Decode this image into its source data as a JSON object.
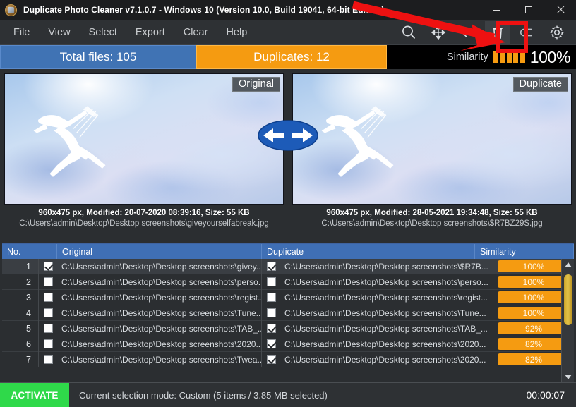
{
  "window": {
    "title": "Duplicate Photo Cleaner v7.1.0.7 - Windows 10 (Version 10.0, Build 19041, 64-bit Edition)",
    "logo_icon": "app-logo-icon",
    "minimize_icon": "minimize-icon",
    "maximize_icon": "maximize-icon",
    "close_icon": "close-icon"
  },
  "menu": {
    "items": [
      {
        "label": "File"
      },
      {
        "label": "View"
      },
      {
        "label": "Select"
      },
      {
        "label": "Export"
      },
      {
        "label": "Clear"
      },
      {
        "label": "Help"
      }
    ]
  },
  "toolbar": {
    "buttons": [
      {
        "name": "search-icon",
        "title": "Search"
      },
      {
        "name": "move-arrows-icon",
        "title": "Move"
      },
      {
        "name": "link-chain-icon",
        "title": "Link"
      },
      {
        "name": "trash-icon",
        "title": "Delete"
      },
      {
        "name": "undo-icon",
        "title": "Undo"
      },
      {
        "name": "gear-icon",
        "title": "Settings"
      }
    ],
    "highlighted": "trash-icon"
  },
  "counters": {
    "total_files_label": "Total files: 105",
    "duplicates_label": "Duplicates: 12",
    "similarity_label": "Similarity",
    "similarity_percent": "100%",
    "similarity_bars": 5,
    "total_color": "#4073b4",
    "duplicates_color": "#f59b11"
  },
  "previews": {
    "left": {
      "badge": "Original",
      "meta": "960x475 px, Modified: 20-07-2020 08:39:16, Size: 55 KB",
      "path": "C:\\Users\\admin\\Desktop\\Desktop screenshots\\giveyourselfabreak.jpg"
    },
    "right": {
      "badge": "Duplicate",
      "meta": "960x475 px, Modified: 28-05-2021 19:34:48, Size: 55 KB",
      "path": "C:\\Users\\admin\\Desktop\\Desktop screenshots\\$R7BZ29S.jpg"
    },
    "swap_icon": "swap-left-right-icon"
  },
  "table": {
    "headers": {
      "no": "No.",
      "original": "Original",
      "duplicate": "Duplicate",
      "similarity": "Similarity"
    },
    "rows": [
      {
        "no": "1",
        "orig_checked": true,
        "orig_path": "C:\\Users\\admin\\Desktop\\Desktop screenshots\\givey...",
        "dupe_checked": true,
        "dupe_path": "C:\\Users\\admin\\Desktop\\Desktop screenshots\\$R7B...",
        "similarity": "100%",
        "selected": true
      },
      {
        "no": "2",
        "orig_checked": false,
        "orig_path": "C:\\Users\\admin\\Desktop\\Desktop screenshots\\perso...",
        "dupe_checked": false,
        "dupe_path": "C:\\Users\\admin\\Desktop\\Desktop screenshots\\perso...",
        "similarity": "100%",
        "selected": false
      },
      {
        "no": "3",
        "orig_checked": false,
        "orig_path": "C:\\Users\\admin\\Desktop\\Desktop screenshots\\regist...",
        "dupe_checked": false,
        "dupe_path": "C:\\Users\\admin\\Desktop\\Desktop screenshots\\regist...",
        "similarity": "100%",
        "selected": false
      },
      {
        "no": "4",
        "orig_checked": false,
        "orig_path": "C:\\Users\\admin\\Desktop\\Desktop screenshots\\Tune...",
        "dupe_checked": false,
        "dupe_path": "C:\\Users\\admin\\Desktop\\Desktop screenshots\\Tune...",
        "similarity": "100%",
        "selected": false
      },
      {
        "no": "5",
        "orig_checked": false,
        "orig_path": "C:\\Users\\admin\\Desktop\\Desktop screenshots\\TAB_...",
        "dupe_checked": true,
        "dupe_path": "C:\\Users\\admin\\Desktop\\Desktop screenshots\\TAB_...",
        "similarity": "92%",
        "selected": false
      },
      {
        "no": "6",
        "orig_checked": false,
        "orig_path": "C:\\Users\\admin\\Desktop\\Desktop screenshots\\2020...",
        "dupe_checked": true,
        "dupe_path": "C:\\Users\\admin\\Desktop\\Desktop screenshots\\2020...",
        "similarity": "82%",
        "selected": false
      },
      {
        "no": "7",
        "orig_checked": false,
        "orig_path": "C:\\Users\\admin\\Desktop\\Desktop screenshots\\Twea...",
        "dupe_checked": true,
        "dupe_path": "C:\\Users\\admin\\Desktop\\Desktop screenshots\\2020...",
        "similarity": "82%",
        "selected": false
      }
    ],
    "scrollbar": {
      "up_icon": "scroll-up-arrow-icon",
      "down_icon": "scroll-down-arrow-icon"
    }
  },
  "status": {
    "activate_label": "ACTIVATE",
    "selection_text": "Current selection mode: Custom (5 items / 3.85 MB selected)",
    "timer": "00:00:07"
  },
  "annotation": {
    "arrow_color": "#ee1111",
    "highlight_target": "trash-icon"
  }
}
